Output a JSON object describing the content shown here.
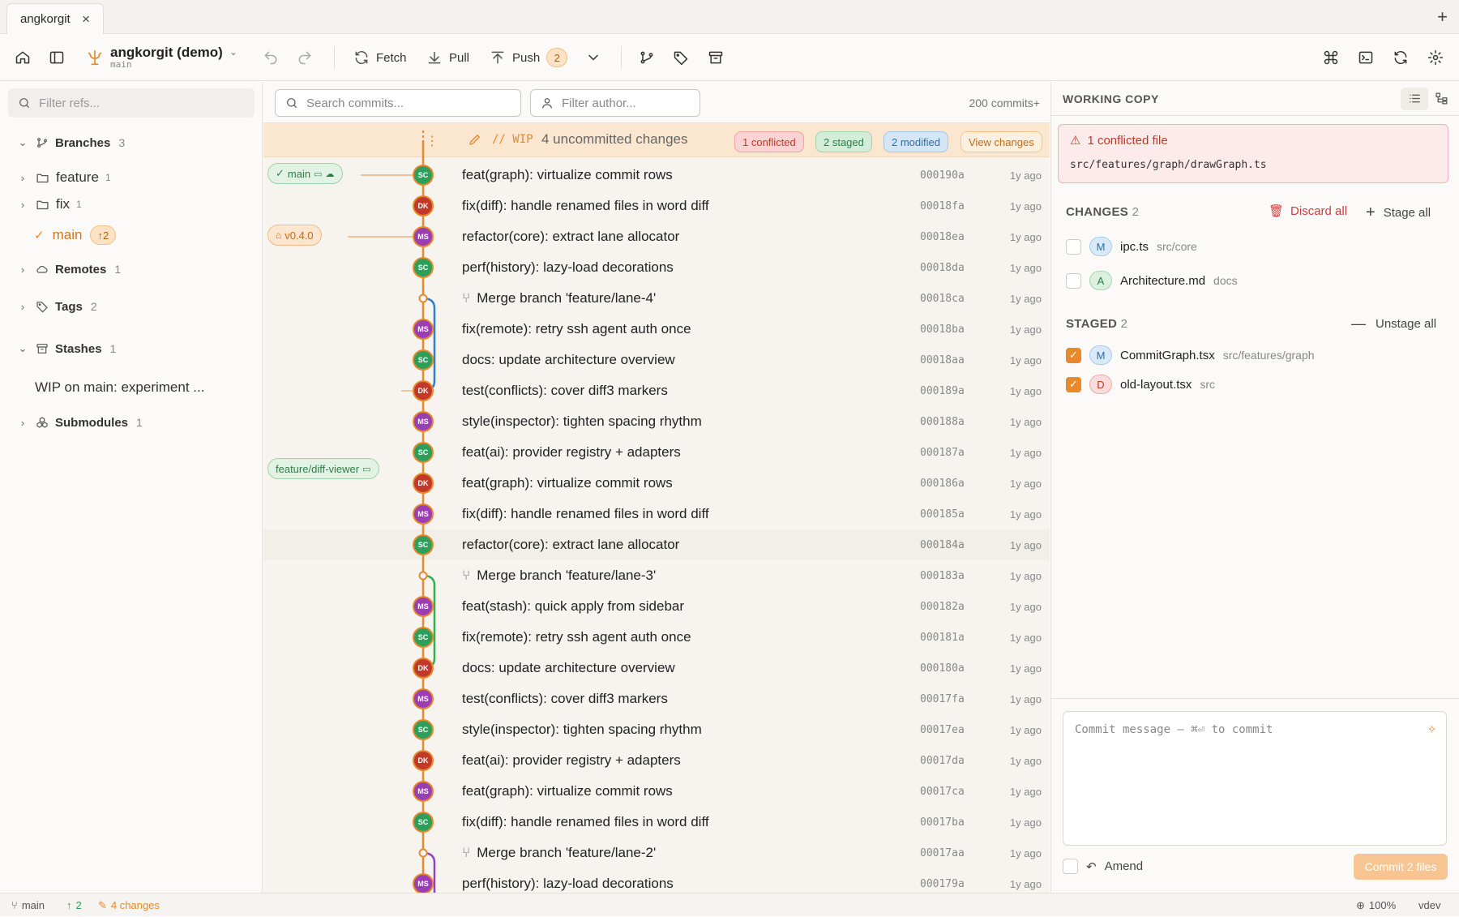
{
  "tab": {
    "title": "angkorgit"
  },
  "toolbar": {
    "repo_name": "angkorgit (demo)",
    "repo_branch": "main",
    "fetch": "Fetch",
    "pull": "Pull",
    "push": "Push",
    "push_count": "2"
  },
  "sidebar": {
    "filter_placeholder": "Filter refs...",
    "branches_label": "Branches",
    "branches_count": "3",
    "feature_label": "feature",
    "feature_count": "1",
    "fix_label": "fix",
    "fix_count": "1",
    "main_label": "main",
    "main_ahead": "↑2",
    "remotes_label": "Remotes",
    "remotes_count": "1",
    "tags_label": "Tags",
    "tags_count": "2",
    "stashes_label": "Stashes",
    "stashes_count": "1",
    "stash_item": "WIP on main: experiment ...",
    "submodules_label": "Submodules",
    "submodules_count": "1"
  },
  "history": {
    "search_placeholder": "Search commits...",
    "author_placeholder": "Filter author...",
    "count": "200 commits+",
    "wip_tag": "// WIP",
    "wip_text": "4 uncommitted changes",
    "conflicted": "1 conflicted",
    "staged": "2 staged",
    "modified": "2 modified",
    "view_changes": "View changes",
    "ref_main": "main",
    "ref_tag": "v0.4.0",
    "ref_feature": "feature/diff-viewer",
    "commits": [
      {
        "author": "SC",
        "message": "feat(graph): virtualize commit rows",
        "hash": "000190a",
        "ago": "1y ago"
      },
      {
        "author": "DK",
        "message": "fix(diff): handle renamed files in word diff",
        "hash": "00018fa",
        "ago": "1y ago"
      },
      {
        "author": "MS",
        "message": "refactor(core): extract lane allocator",
        "hash": "00018ea",
        "ago": "1y ago"
      },
      {
        "author": "SC",
        "message": "perf(history): lazy-load decorations",
        "hash": "00018da",
        "ago": "1y ago"
      },
      {
        "author": "",
        "message": "Merge branch 'feature/lane-4'",
        "hash": "00018ca",
        "ago": "1y ago"
      },
      {
        "author": "MS",
        "message": "fix(remote): retry ssh agent auth once",
        "hash": "00018ba",
        "ago": "1y ago"
      },
      {
        "author": "SC",
        "message": "docs: update architecture overview",
        "hash": "00018aa",
        "ago": "1y ago"
      },
      {
        "author": "DK",
        "message": "test(conflicts): cover diff3 markers",
        "hash": "000189a",
        "ago": "1y ago"
      },
      {
        "author": "MS",
        "message": "style(inspector): tighten spacing rhythm",
        "hash": "000188a",
        "ago": "1y ago"
      },
      {
        "author": "SC",
        "message": "feat(ai): provider registry + adapters",
        "hash": "000187a",
        "ago": "1y ago"
      },
      {
        "author": "DK",
        "message": "feat(graph): virtualize commit rows",
        "hash": "000186a",
        "ago": "1y ago"
      },
      {
        "author": "MS",
        "message": "fix(diff): handle renamed files in word diff",
        "hash": "000185a",
        "ago": "1y ago"
      },
      {
        "author": "SC",
        "message": "refactor(core): extract lane allocator",
        "hash": "000184a",
        "ago": "1y ago"
      },
      {
        "author": "",
        "message": "Merge branch 'feature/lane-3'",
        "hash": "000183a",
        "ago": "1y ago"
      },
      {
        "author": "MS",
        "message": "feat(stash): quick apply from sidebar",
        "hash": "000182a",
        "ago": "1y ago"
      },
      {
        "author": "SC",
        "message": "fix(remote): retry ssh agent auth once",
        "hash": "000181a",
        "ago": "1y ago"
      },
      {
        "author": "DK",
        "message": "docs: update architecture overview",
        "hash": "000180a",
        "ago": "1y ago"
      },
      {
        "author": "MS",
        "message": "test(conflicts): cover diff3 markers",
        "hash": "00017fa",
        "ago": "1y ago"
      },
      {
        "author": "SC",
        "message": "style(inspector): tighten spacing rhythm",
        "hash": "00017ea",
        "ago": "1y ago"
      },
      {
        "author": "DK",
        "message": "feat(ai): provider registry + adapters",
        "hash": "00017da",
        "ago": "1y ago"
      },
      {
        "author": "MS",
        "message": "feat(graph): virtualize commit rows",
        "hash": "00017ca",
        "ago": "1y ago"
      },
      {
        "author": "SC",
        "message": "fix(diff): handle renamed files in word diff",
        "hash": "00017ba",
        "ago": "1y ago"
      },
      {
        "author": "",
        "message": "Merge branch 'feature/lane-2'",
        "hash": "00017aa",
        "ago": "1y ago"
      },
      {
        "author": "MS",
        "message": "perf(history): lazy-load decorations",
        "hash": "000179a",
        "ago": "1y ago"
      }
    ]
  },
  "working_copy": {
    "title": "WORKING COPY",
    "conflict_title": "1 conflicted file",
    "conflict_path": "src/features/graph/drawGraph.ts",
    "changes_label": "CHANGES",
    "changes_count": "2",
    "discard_all": "Discard all",
    "stage_all": "Stage all",
    "changes": [
      {
        "status": "M",
        "name": "ipc.ts",
        "path": "src/core"
      },
      {
        "status": "A",
        "name": "Architecture.md",
        "path": "docs"
      }
    ],
    "staged_label": "STAGED",
    "staged_count": "2",
    "unstage_all": "Unstage all",
    "staged": [
      {
        "status": "M",
        "name": "CommitGraph.tsx",
        "path": "src/features/graph"
      },
      {
        "status": "D",
        "name": "old-layout.tsx",
        "path": "src"
      }
    ],
    "commit_placeholder": "Commit message  —  ⌘⏎ to commit",
    "amend": "Amend",
    "commit_button": "Commit 2 files"
  },
  "status_bar": {
    "branch": "main",
    "ahead": "2",
    "changes": "4 changes",
    "zoom": "100%",
    "env": "vdev"
  },
  "colors": {
    "accent": "#e8892c",
    "SC": "#2e9e5b",
    "DK": "#c0392b",
    "MS": "#9b3db3"
  }
}
